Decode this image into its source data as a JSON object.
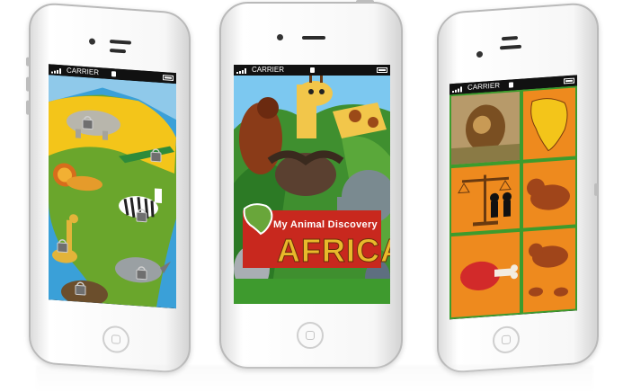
{
  "status_bar": {
    "carrier": "CARRIER"
  },
  "splash": {
    "subtitle": "My Animal Discovery",
    "title": "AFRICA"
  },
  "icons": {
    "left_screen": [
      "padlock-icon",
      "hippo-icon",
      "crocodile-icon",
      "lion-icon",
      "zebra-icon",
      "giraffe-icon",
      "rhino-icon",
      "buffalo-icon"
    ],
    "right_screen": [
      "lion-photo",
      "africa-map-icon",
      "scale-icon",
      "lion-silhouette-icon",
      "meat-icon",
      "lion-family-icon"
    ]
  },
  "colors": {
    "ocean": "#3aa0d8",
    "grass": "#6aa62c",
    "sand": "#f3c51a",
    "orange": "#ee8a1e",
    "green_grid": "#3d9b2d",
    "banner_red": "#c8281e"
  }
}
